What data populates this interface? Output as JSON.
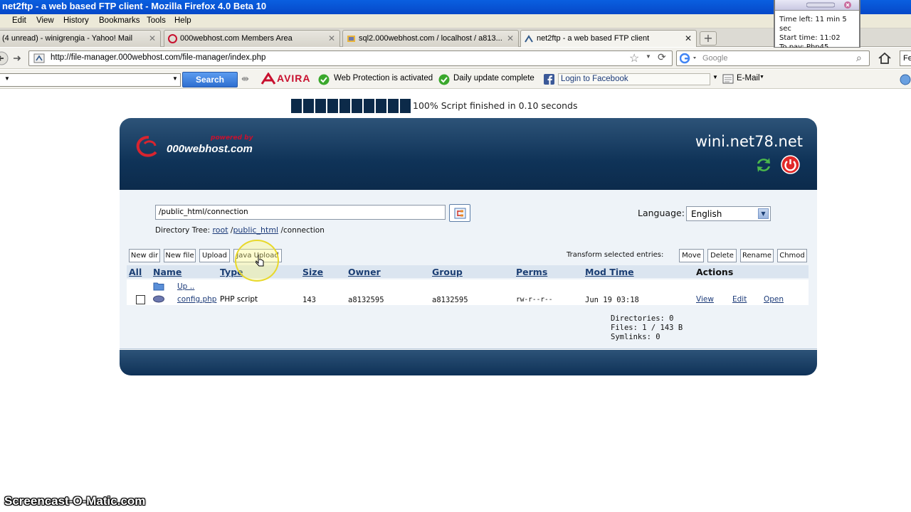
{
  "window": {
    "title": "net2ftp - a web based FTP client - Mozilla Firefox 4.0 Beta 10"
  },
  "menu": [
    "Edit",
    "View",
    "History",
    "Bookmarks",
    "Tools",
    "Help"
  ],
  "tabs": [
    {
      "label": "(4 unread) - winigrengia - Yahoo! Mail"
    },
    {
      "label": "000webhost.com Members Area"
    },
    {
      "label": "sql2.000webhost.com / localhost / a813..."
    },
    {
      "label": "net2ftp - a web based FTP client"
    }
  ],
  "nav": {
    "url": "http://file-manager.000webhost.com/file-manager/index.php",
    "search_placeholder": "Google",
    "right_edge_text": "Fe"
  },
  "toolbar": {
    "search_button": "Search",
    "avira": "AVIRA",
    "web_protection": "Web Protection is activated",
    "daily_update": "Daily update complete",
    "facebook_login": "Login to Facebook",
    "email": "E-Mail"
  },
  "timer": {
    "time_left": "Time left: 11 min 5 sec",
    "start_time": "Start time: 11:02",
    "to_pay": "To pay: Php45"
  },
  "progress": {
    "text": "100% Script finished in 0.10 seconds",
    "percent": 100,
    "blocks": 10
  },
  "panel": {
    "logo_powered": "powered by",
    "logo_brand": "000webhost.com",
    "site": "wini.net78.net",
    "path_value": "/public_html/connection",
    "language_label": "Language:",
    "language_value": "English",
    "dirtree_label": "Directory Tree:",
    "dirtree_root": "root",
    "dirtree_public": "public_html",
    "dirtree_current": "connection",
    "buttons_left": [
      "New dir",
      "New file",
      "Upload",
      "Java Upload"
    ],
    "transform_label": "Transform selected entries:",
    "buttons_right": [
      "Move",
      "Delete",
      "Rename",
      "Chmod"
    ],
    "columns": [
      "All",
      "Name",
      "Type",
      "Size",
      "Owner",
      "Group",
      "Perms",
      "Mod Time",
      "Actions"
    ],
    "up_link": "Up ..",
    "file": {
      "name": "config.php",
      "type": "PHP script",
      "size": "143",
      "owner": "a8132595",
      "group": "a8132595",
      "perms": "rw-r--r--",
      "mod_time": "Jun 19 03:18",
      "actions": [
        "View",
        "Edit",
        "Open"
      ]
    },
    "summary": {
      "directories": "Directories: 0",
      "files": "Files: 1 / 143 B",
      "symlinks": "Symlinks: 0"
    }
  },
  "watermark": "Screencast-O-Matic.com",
  "colors": {
    "header": "#0f3358",
    "body": "#eef3f8",
    "link": "#1b3a78",
    "titlebar": "#0648c8",
    "avira_red": "#c8102e",
    "fb_blue": "#3b5998"
  }
}
